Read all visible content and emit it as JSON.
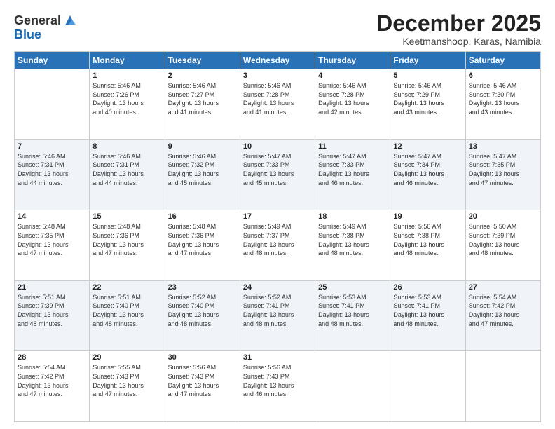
{
  "header": {
    "logo_general": "General",
    "logo_blue": "Blue",
    "month_title": "December 2025",
    "subtitle": "Keetmanshoop, Karas, Namibia"
  },
  "weekdays": [
    "Sunday",
    "Monday",
    "Tuesday",
    "Wednesday",
    "Thursday",
    "Friday",
    "Saturday"
  ],
  "weeks": [
    [
      {
        "day": "",
        "info": ""
      },
      {
        "day": "1",
        "info": "Sunrise: 5:46 AM\nSunset: 7:26 PM\nDaylight: 13 hours\nand 40 minutes."
      },
      {
        "day": "2",
        "info": "Sunrise: 5:46 AM\nSunset: 7:27 PM\nDaylight: 13 hours\nand 41 minutes."
      },
      {
        "day": "3",
        "info": "Sunrise: 5:46 AM\nSunset: 7:28 PM\nDaylight: 13 hours\nand 41 minutes."
      },
      {
        "day": "4",
        "info": "Sunrise: 5:46 AM\nSunset: 7:28 PM\nDaylight: 13 hours\nand 42 minutes."
      },
      {
        "day": "5",
        "info": "Sunrise: 5:46 AM\nSunset: 7:29 PM\nDaylight: 13 hours\nand 43 minutes."
      },
      {
        "day": "6",
        "info": "Sunrise: 5:46 AM\nSunset: 7:30 PM\nDaylight: 13 hours\nand 43 minutes."
      }
    ],
    [
      {
        "day": "7",
        "info": "Sunrise: 5:46 AM\nSunset: 7:31 PM\nDaylight: 13 hours\nand 44 minutes."
      },
      {
        "day": "8",
        "info": "Sunrise: 5:46 AM\nSunset: 7:31 PM\nDaylight: 13 hours\nand 44 minutes."
      },
      {
        "day": "9",
        "info": "Sunrise: 5:46 AM\nSunset: 7:32 PM\nDaylight: 13 hours\nand 45 minutes."
      },
      {
        "day": "10",
        "info": "Sunrise: 5:47 AM\nSunset: 7:33 PM\nDaylight: 13 hours\nand 45 minutes."
      },
      {
        "day": "11",
        "info": "Sunrise: 5:47 AM\nSunset: 7:33 PM\nDaylight: 13 hours\nand 46 minutes."
      },
      {
        "day": "12",
        "info": "Sunrise: 5:47 AM\nSunset: 7:34 PM\nDaylight: 13 hours\nand 46 minutes."
      },
      {
        "day": "13",
        "info": "Sunrise: 5:47 AM\nSunset: 7:35 PM\nDaylight: 13 hours\nand 47 minutes."
      }
    ],
    [
      {
        "day": "14",
        "info": "Sunrise: 5:48 AM\nSunset: 7:35 PM\nDaylight: 13 hours\nand 47 minutes."
      },
      {
        "day": "15",
        "info": "Sunrise: 5:48 AM\nSunset: 7:36 PM\nDaylight: 13 hours\nand 47 minutes."
      },
      {
        "day": "16",
        "info": "Sunrise: 5:48 AM\nSunset: 7:36 PM\nDaylight: 13 hours\nand 47 minutes."
      },
      {
        "day": "17",
        "info": "Sunrise: 5:49 AM\nSunset: 7:37 PM\nDaylight: 13 hours\nand 48 minutes."
      },
      {
        "day": "18",
        "info": "Sunrise: 5:49 AM\nSunset: 7:38 PM\nDaylight: 13 hours\nand 48 minutes."
      },
      {
        "day": "19",
        "info": "Sunrise: 5:50 AM\nSunset: 7:38 PM\nDaylight: 13 hours\nand 48 minutes."
      },
      {
        "day": "20",
        "info": "Sunrise: 5:50 AM\nSunset: 7:39 PM\nDaylight: 13 hours\nand 48 minutes."
      }
    ],
    [
      {
        "day": "21",
        "info": "Sunrise: 5:51 AM\nSunset: 7:39 PM\nDaylight: 13 hours\nand 48 minutes."
      },
      {
        "day": "22",
        "info": "Sunrise: 5:51 AM\nSunset: 7:40 PM\nDaylight: 13 hours\nand 48 minutes."
      },
      {
        "day": "23",
        "info": "Sunrise: 5:52 AM\nSunset: 7:40 PM\nDaylight: 13 hours\nand 48 minutes."
      },
      {
        "day": "24",
        "info": "Sunrise: 5:52 AM\nSunset: 7:41 PM\nDaylight: 13 hours\nand 48 minutes."
      },
      {
        "day": "25",
        "info": "Sunrise: 5:53 AM\nSunset: 7:41 PM\nDaylight: 13 hours\nand 48 minutes."
      },
      {
        "day": "26",
        "info": "Sunrise: 5:53 AM\nSunset: 7:41 PM\nDaylight: 13 hours\nand 48 minutes."
      },
      {
        "day": "27",
        "info": "Sunrise: 5:54 AM\nSunset: 7:42 PM\nDaylight: 13 hours\nand 47 minutes."
      }
    ],
    [
      {
        "day": "28",
        "info": "Sunrise: 5:54 AM\nSunset: 7:42 PM\nDaylight: 13 hours\nand 47 minutes."
      },
      {
        "day": "29",
        "info": "Sunrise: 5:55 AM\nSunset: 7:43 PM\nDaylight: 13 hours\nand 47 minutes."
      },
      {
        "day": "30",
        "info": "Sunrise: 5:56 AM\nSunset: 7:43 PM\nDaylight: 13 hours\nand 47 minutes."
      },
      {
        "day": "31",
        "info": "Sunrise: 5:56 AM\nSunset: 7:43 PM\nDaylight: 13 hours\nand 46 minutes."
      },
      {
        "day": "",
        "info": ""
      },
      {
        "day": "",
        "info": ""
      },
      {
        "day": "",
        "info": ""
      }
    ]
  ]
}
